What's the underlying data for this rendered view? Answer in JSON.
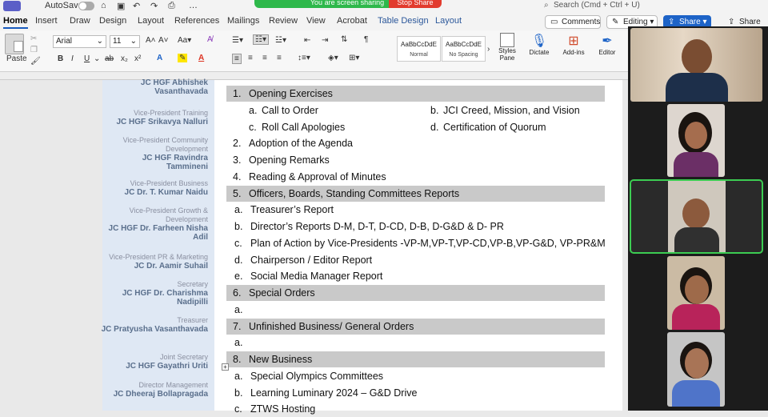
{
  "titlebar": {
    "autosave": "AutoSave",
    "sharing_banner": "You are screen sharing",
    "stop_share": "Stop Share",
    "search_placeholder": "Search (Cmd + Ctrl + U)"
  },
  "tabs": [
    "Home",
    "Insert",
    "Draw",
    "Design",
    "Layout",
    "References",
    "Mailings",
    "Review",
    "View",
    "Acrobat",
    "Table Design",
    "Layout"
  ],
  "right_buttons": {
    "comments": "Comments",
    "editing": "Editing",
    "share": "Share",
    "share2": "Share"
  },
  "ribbon": {
    "paste": "Paste",
    "font": "Arial",
    "size": "11",
    "styles": [
      {
        "preview": "AaBbCcDdE",
        "name": "Normal"
      },
      {
        "preview": "AaBbCcDdE",
        "name": "No Spacing"
      }
    ],
    "styles_pane": "Styles\nPane",
    "dictate": "Dictate",
    "addins": "Add-ins",
    "editor": "Editor"
  },
  "sidebar": [
    {
      "role": "",
      "name": "JC HGF Abhishek Vasanthavada"
    },
    {
      "role": "Vice-President Training",
      "name": "JC HGF Srikavya Nalluri"
    },
    {
      "role": "Vice-President Community Development",
      "name": "JC HGF Ravindra Tammineni"
    },
    {
      "role": "Vice-President Business",
      "name": "JC Dr. T. Kumar Naidu"
    },
    {
      "role": "Vice-President Growth & Development",
      "name": "JC HGF Dr. Farheen Nisha Adil"
    },
    {
      "role": "Vice-President PR & Marketing",
      "name": "JC Dr. Aamir Suhail"
    },
    {
      "role": "Secretary",
      "name": "JC HGF Dr. Charishma Nadipilli"
    },
    {
      "role": "Treasurer",
      "name": "JC Pratyusha Vasanthavada"
    },
    {
      "role": "Joint Secretary",
      "name": "JC HGF Gayathri Uriti"
    },
    {
      "role": "Director Management",
      "name": "JC Dheeraj Bollapragada"
    }
  ],
  "agenda": [
    {
      "num": "1.",
      "text": "Opening Exercises",
      "shade": true
    },
    {
      "num": "a.",
      "text": "Call to Order",
      "num2": "b.",
      "text2": "JCI Creed, Mission, and Vision",
      "indent": true
    },
    {
      "num": "c.",
      "text": "Roll Call Apologies",
      "num2": "d.",
      "text2": "Certification of Quorum",
      "indent": true
    },
    {
      "num": "2.",
      "text": "Adoption of the Agenda"
    },
    {
      "num": "3.",
      "text": "Opening Remarks"
    },
    {
      "num": "4.",
      "text": "Reading & Approval of Minutes"
    },
    {
      "num": "5.",
      "text": "Officers, Boards, Standing Committees Reports",
      "shade": true
    },
    {
      "num": "a.",
      "text": "Treasurer’s Report",
      "sub": true
    },
    {
      "num": "b.",
      "text": "Director’s Reports D-M, D-T, D-CD, D-B, D-G&D & D- PR",
      "sub": true
    },
    {
      "num": "c.",
      "text": "Plan of Action by Vice-Presidents -VP-M,VP-T,VP-CD,VP-B,VP-G&D, VP-PR&M",
      "sub": true
    },
    {
      "num": "d.",
      "text": "Chairperson / Editor Report",
      "sub": true
    },
    {
      "num": "e.",
      "text": "Social Media Manager Report",
      "sub": true
    },
    {
      "num": "6.",
      "text": "Special Orders",
      "shade": true
    },
    {
      "num": "a.",
      "text": "",
      "sub": true
    },
    {
      "num": "7.",
      "text": "Unfinished Business/ General Orders",
      "shade": true
    },
    {
      "num": "a.",
      "text": "",
      "sub": true
    },
    {
      "num": "8.",
      "text": "New Business",
      "shade": true
    },
    {
      "num": "a.",
      "text": "Special Olympics Committees",
      "sub": true
    },
    {
      "num": "b.",
      "text": "Learning Luminary 2024 – G&D Drive",
      "sub": true
    },
    {
      "num": "c.",
      "text": "ZTWS Hosting",
      "sub": true
    }
  ]
}
